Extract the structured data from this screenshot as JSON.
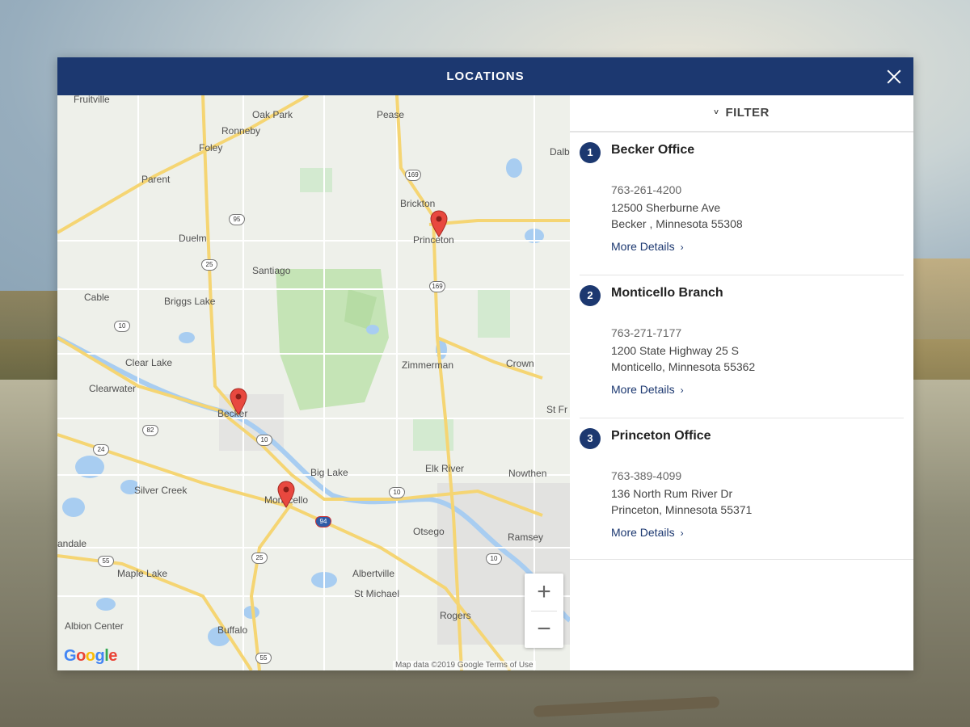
{
  "modal": {
    "title": "LOCATIONS"
  },
  "filter": {
    "label": "FILTER",
    "chevron": "˅"
  },
  "locations": [
    {
      "number": "1",
      "name": "Becker Office",
      "phone": "763-261-4200",
      "street": "12500 Sherburne Ave",
      "city": "Becker , Minnesota 55308",
      "more": "More Details",
      "more_icon": "›"
    },
    {
      "number": "2",
      "name": "Monticello Branch",
      "phone": "763-271-7177",
      "street": "1200 State Highway 25 S",
      "city": "Monticello, Minnesota 55362",
      "more": "More Details",
      "more_icon": "›"
    },
    {
      "number": "3",
      "name": "Princeton Office",
      "phone": "763-389-4099",
      "street": "136 North Rum River Dr",
      "city": "Princeton, Minnesota 55371",
      "more": "More Details",
      "more_icon": "›"
    }
  ],
  "map": {
    "labels": {
      "fruitville": "Fruitville",
      "oak_park": "Oak Park",
      "pease": "Pease",
      "ronneby": "Ronneby",
      "foley": "Foley",
      "dalbo": "Dalb",
      "parent": "Parent",
      "brickton": "Brickton",
      "princeton": "Princeton",
      "duelm": "Duelm",
      "santiago": "Santiago",
      "cable": "Cable",
      "briggs_lake": "Briggs Lake",
      "clear_lake": "Clear Lake",
      "zimmerman": "Zimmerman",
      "crown": "Crown",
      "clearwater": "Clearwater",
      "becker": "Becker",
      "st_fr": "St Fr",
      "big_lake": "Big Lake",
      "elk_river": "Elk River",
      "nowthen": "Nowthen",
      "silver_creek": "Silver Creek",
      "monticello": "Monticello",
      "otsego": "Otsego",
      "ramsey": "Ramsey",
      "annandale": "andale",
      "maple_lake": "Maple Lake",
      "albertville": "Albertville",
      "st_michael": "St Michael",
      "rogers": "Rogers",
      "albion_center": "Albion Center",
      "buffalo": "Buffalo"
    },
    "shields": {
      "h169a": "169",
      "h95": "95",
      "h25a": "25",
      "h169b": "169",
      "h10a": "10",
      "h82": "82",
      "h10b": "10",
      "h24": "24",
      "h10c": "10",
      "h94": "94",
      "h25b": "25",
      "h55": "55",
      "h10d": "10",
      "h55b": "55"
    },
    "zoom_in": "+",
    "zoom_out": "−",
    "logo": "Google",
    "footer": "Map data ©2019 Google   Terms of Use",
    "pin_color": "#e8483f",
    "road_color": "#f5d573",
    "water_color": "#a8cdf1",
    "park_color": "#c5e4b6"
  },
  "colors": {
    "navy": "#1c3870"
  }
}
